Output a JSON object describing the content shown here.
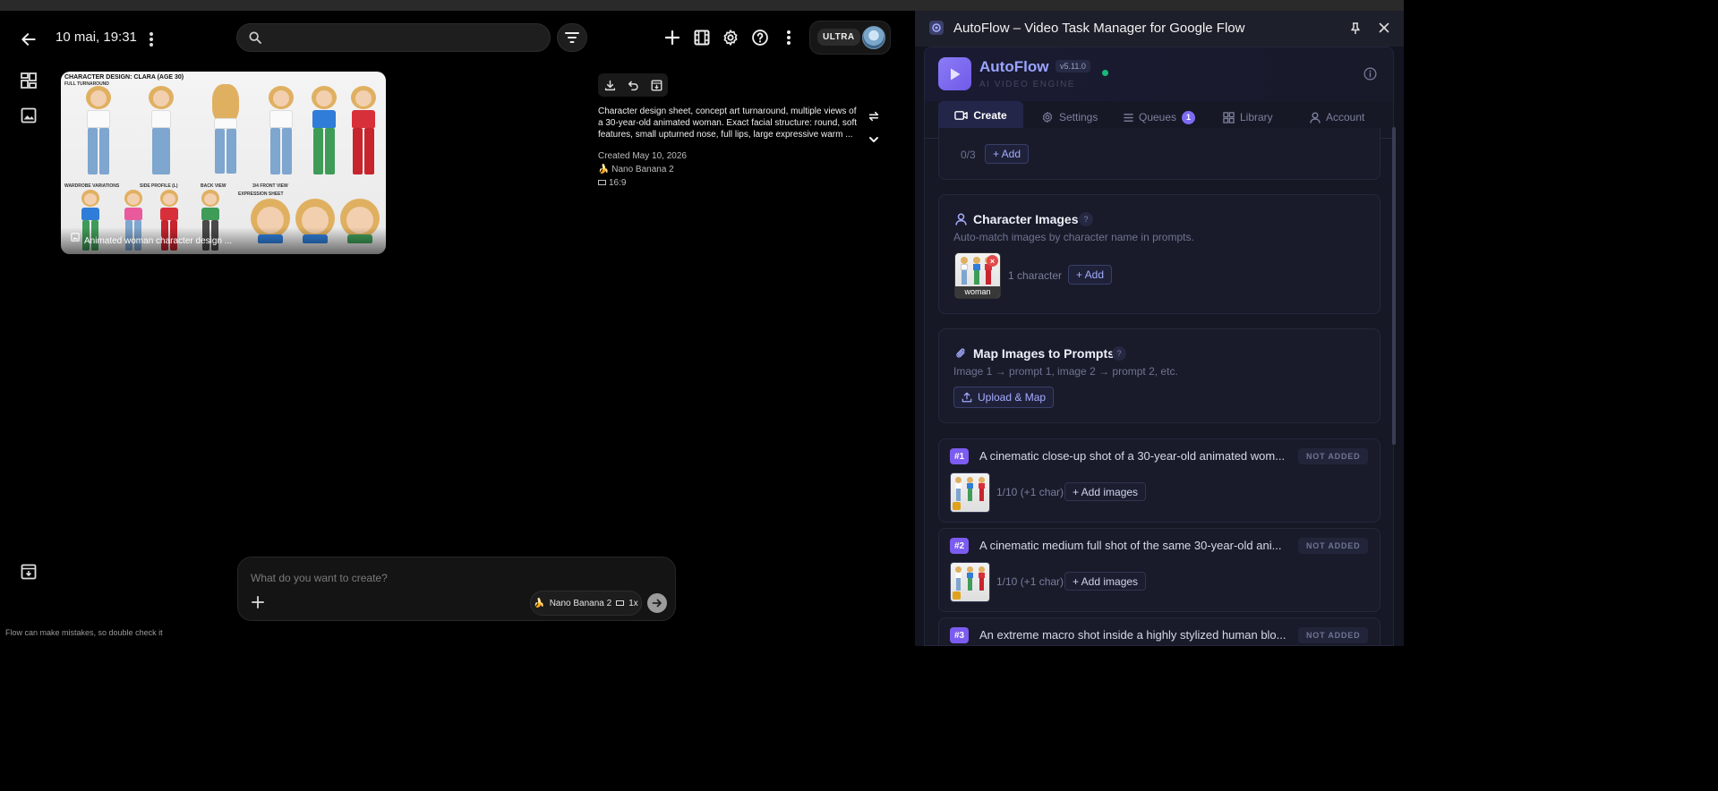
{
  "flow": {
    "date": "10 mai, 19:31",
    "search": {
      "placeholder": "",
      "value": ""
    },
    "plan_badge": "ULTRA",
    "thumbnail": {
      "sheet_title": "CHARACTER DESIGN: CLARA (AGE 30)",
      "sheet_label_turnaround": "FULL TURNAROUND",
      "sheet_label_wardrobe": "WARDROBE VARIATIONS",
      "sheet_label_side": "SIDE PROFILE (L)",
      "sheet_label_back": "BACK VIEW",
      "sheet_label_three_quarter": "3/4 FRONT VIEW",
      "sheet_label_expression": "EXPRESSION SHEET",
      "caption": "Animated woman character design ..."
    },
    "description": "Character design sheet, concept art turnaround, multiple views of a 30-year-old animated woman. Exact facial structure: round, soft features, small upturned nose, full lips, large expressive warm ...",
    "created": "Created May 10, 2026",
    "model": "Nano Banana 2",
    "aspect": "16:9",
    "composer": {
      "placeholder": "What do you want to create?",
      "model_chip": "Nano Banana 2",
      "count": "1x"
    },
    "footer_note": "Flow can make mistakes, so double check it",
    "icons": {
      "back": "arrow-left-icon",
      "more": "more-vertical-icon",
      "search": "search-icon",
      "filter": "filter-icon",
      "add": "plus-icon",
      "scenes": "film-icon",
      "settings": "gear-icon",
      "help": "help-circle-icon",
      "grid": "dashboard-grid-icon",
      "image": "image-icon",
      "archive": "archive-icon"
    }
  },
  "panel": {
    "window_title": "AutoFlow – Video Task Manager for Google Flow",
    "brand_name": "AutoFlow",
    "version": "v5.11.0",
    "subtitle": "AI VIDEO ENGINE",
    "tabs": [
      {
        "label": "Create"
      },
      {
        "label": "Settings"
      },
      {
        "label": "Queues",
        "badge": "1"
      },
      {
        "label": "Library"
      },
      {
        "label": "Account"
      }
    ],
    "top_card": {
      "count": "0/3",
      "add_label": "+ Add"
    },
    "character_images": {
      "title": "Character Images",
      "help": "?",
      "description": "Auto-match images by character name in prompts.",
      "char_label": "woman",
      "remove": "×",
      "count": "1 character",
      "add_label": "+ Add"
    },
    "map_images": {
      "title": "Map Images to Prompts",
      "help": "?",
      "description": "Image 1 → prompt 1, image 2 → prompt 2, etc.",
      "upload_label": "Upload & Map"
    },
    "prompts": [
      {
        "num": "#1",
        "text": "A cinematic close-up shot of a 30-year-old animated wom...",
        "status": "NOT ADDED",
        "count": "1/10 (+1 char)",
        "add_label": "+ Add images"
      },
      {
        "num": "#2",
        "text": "A cinematic medium full shot of the same 30-year-old ani...",
        "status": "NOT ADDED",
        "count": "1/10 (+1 char)",
        "add_label": "+ Add images"
      },
      {
        "num": "#3",
        "text": "An extreme macro shot inside a highly stylized human blo...",
        "status": "NOT ADDED",
        "count": "",
        "add_label": ""
      }
    ],
    "colors": {
      "accent": "#7c5cf0",
      "brand": "#9aa3ff",
      "status_dot": "#17b978"
    }
  }
}
